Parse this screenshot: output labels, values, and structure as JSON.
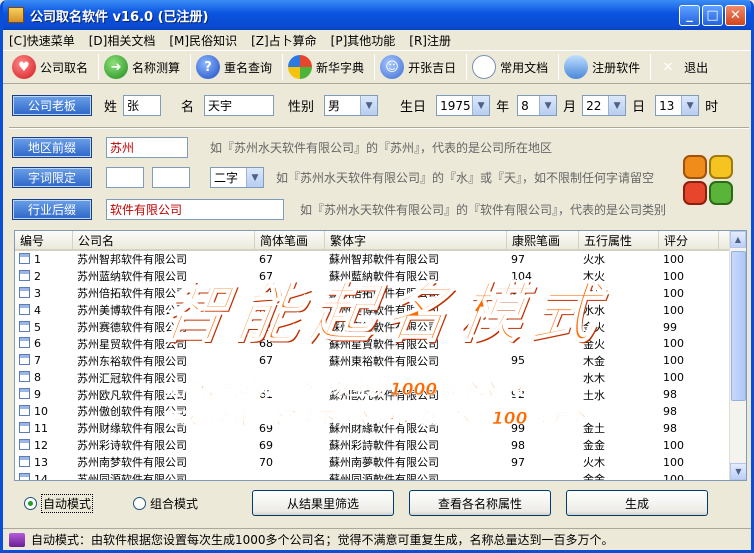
{
  "window": {
    "title": "公司取名软件 v16.0 (已注册)"
  },
  "menu": [
    "[C]快速菜单",
    "[D]相关文档",
    "[M]民俗知识",
    "[Z]占卜算命",
    "[P]其他功能",
    "[R]注册"
  ],
  "toolbar": [
    {
      "label": "公司取名",
      "icon": "heart-icon"
    },
    {
      "label": "名称测算",
      "icon": "arrow-icon"
    },
    {
      "label": "重名查询",
      "icon": "help-icon"
    },
    {
      "label": "新华字典",
      "icon": "windows-icon"
    },
    {
      "label": "开张吉日",
      "icon": "calendar-icon"
    },
    {
      "label": "常用文档",
      "icon": "document-icon"
    },
    {
      "label": "注册软件",
      "icon": "register-icon"
    },
    {
      "label": "退出",
      "icon": "exit-icon"
    }
  ],
  "boss": {
    "button": "公司老板",
    "surname_label": "姓",
    "surname": "张",
    "name_label": "名",
    "name": "天宇",
    "gender_label": "性别",
    "gender": "男",
    "birthday_label": "生日",
    "year": "1975",
    "year_label": "年",
    "month": "8",
    "month_label": "月",
    "day": "22",
    "day_label": "日",
    "hour": "13",
    "hour_label": "时"
  },
  "prefix": {
    "button": "地区前缀",
    "value": "苏州",
    "hint": "如『苏州水天软件有限公司』的『苏州』，代表的是公司所在地区"
  },
  "limit": {
    "button": "字词限定",
    "value1": "",
    "value2": "",
    "select": "二字",
    "hint": "如『苏州水天软件有限公司』的『水』或『天』，如不限制任何字请留空"
  },
  "suffix": {
    "button": "行业后缀",
    "value": "软件有限公司",
    "hint": "如『苏州水天软件有限公司』的『软件有限公司』，代表的是公司类别"
  },
  "table": {
    "headers": [
      "编号",
      "公司名",
      "简体笔画",
      "繁体字",
      "康熙笔画",
      "五行属性",
      "评分"
    ],
    "rows": [
      [
        "1",
        "苏州智邦软件有限公司",
        "67",
        "蘇州智邦軟件有限公司",
        "97",
        "火水",
        "100"
      ],
      [
        "2",
        "苏州蓝纳软件有限公司",
        "67",
        "蘇州藍納軟件有限公司",
        "104",
        "木火",
        "100"
      ],
      [
        "3",
        "苏州倍拓软件有限公司",
        "67",
        "蘇州倍拓軟件有限公司",
        "93",
        "水火",
        "100"
      ],
      [
        "4",
        "苏州美博软件有限公司",
        "69",
        "蘇州美博軟件有限公司",
        "95",
        "水水",
        "100"
      ],
      [
        "5",
        "苏州赛德软件有限公司",
        "71",
        "蘇州賽德軟件有限公司",
        "",
        "金火",
        "99"
      ],
      [
        "6",
        "苏州星贸软件有限公司",
        "68",
        "蘇州星貿軟件有限公司",
        "",
        "金火",
        "100"
      ],
      [
        "7",
        "苏州东裕软件有限公司",
        "67",
        "蘇州東裕軟件有限公司",
        "95",
        "木金",
        "100"
      ],
      [
        "8",
        "苏州汇冠软件有限公司",
        "",
        "",
        "",
        "水木",
        "100"
      ],
      [
        "9",
        "苏州欧凡软件有限公司",
        "61",
        "蘇州歐凡軟件有限公司",
        "92",
        "土水",
        "98"
      ],
      [
        "10",
        "苏州傲创软件有限公司",
        "",
        "",
        "",
        "",
        "98"
      ],
      [
        "11",
        "苏州财缘软件有限公司",
        "69",
        "蘇州財緣軟件有限公司",
        "99",
        "金土",
        "98"
      ],
      [
        "12",
        "苏州彩诗软件有限公司",
        "69",
        "蘇州彩詩軟件有限公司",
        "98",
        "金金",
        "100"
      ],
      [
        "13",
        "苏州南梦软件有限公司",
        "70",
        "蘇州南夢軟件有限公司",
        "97",
        "火木",
        "100"
      ],
      [
        "14",
        "苏州同源软件有限公司",
        "",
        "蘇州同源軟件有限公司",
        "",
        "金金",
        "100"
      ]
    ]
  },
  "overlay": {
    "title": "智能起名模式",
    "line1": "软件根据您设置智能每次生成 1000 多个公司名",
    "line2": "每次点生成都会产生不用公司名，总量达到 100 多万个"
  },
  "mode": {
    "auto": "自动模式",
    "combo": "组合模式"
  },
  "buttons": {
    "filter": "从结果里筛选",
    "check": "查看各名称属性",
    "generate": "生成"
  },
  "status": "自动模式：由软件根据您设置每次生成1000多个公司名；觉得不满意可重复生成，名称总量达到一百多万个。",
  "colors": {
    "accent": "#2d66c8",
    "overlay": "#ff6a00",
    "red_text": "#c00000"
  }
}
